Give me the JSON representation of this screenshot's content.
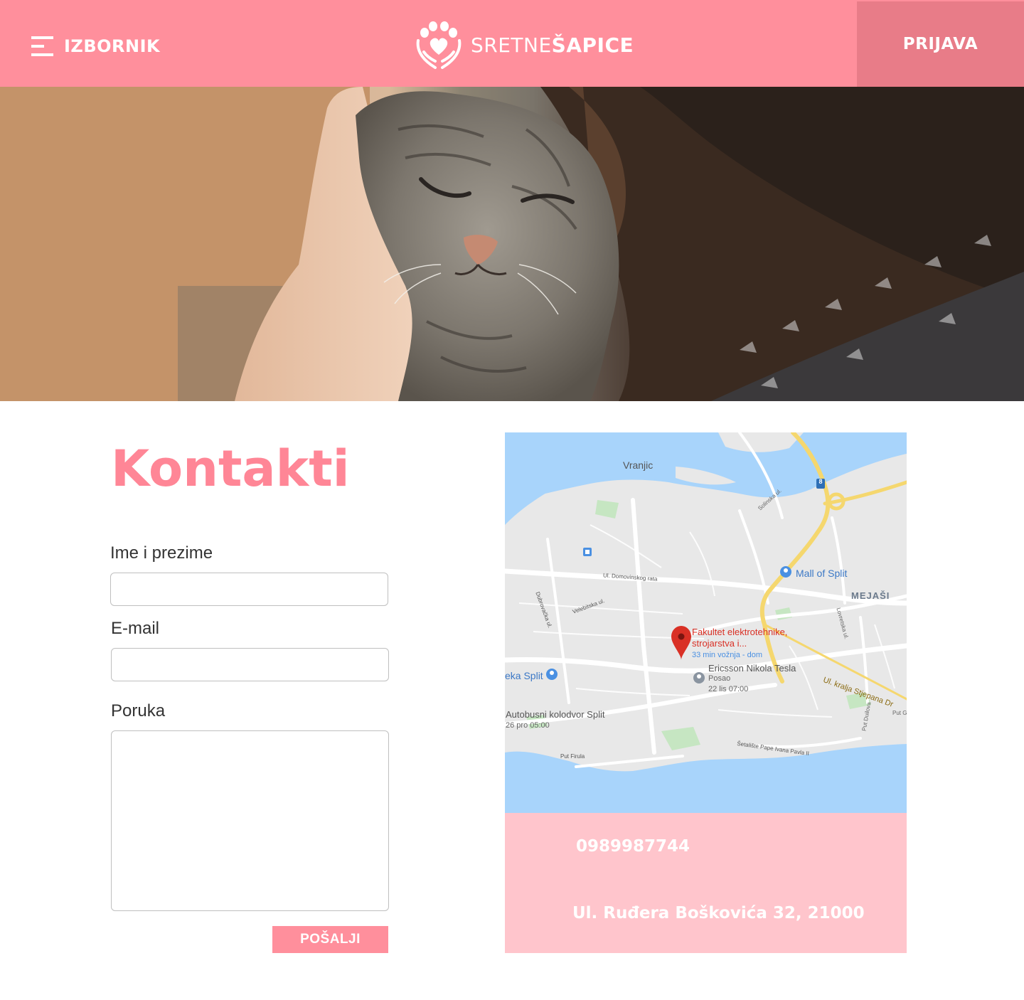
{
  "header": {
    "menu_label": "IZBORNIK",
    "logo_text_light": "SRETNE",
    "logo_text_bold": "ŠAPICE",
    "login_label": "PRIJAVA",
    "brand_color": "#ff8f9c",
    "login_bg_color": "#e87c88"
  },
  "contact": {
    "title": "Kontakti",
    "fields": {
      "name_label": "Ime i prezime",
      "email_label": "E-mail",
      "message_label": "Poruka",
      "name_value": "",
      "email_value": "",
      "message_value": ""
    },
    "send_label": "POŠALJI"
  },
  "map": {
    "labels": {
      "vranjic": "Vranjic",
      "mall": "Mall of Split",
      "mejasi": "MEJAŠI",
      "pin_line1": "Fakultet elektrotehnike,",
      "pin_line2": "strojarstva i...",
      "pin_sub": "33 min vožnja - dom",
      "ericsson": "Ericsson Nikola Tesla",
      "ericsson_sub1": "Posao",
      "ericsson_sub2": "22 lis 07:00",
      "bus": "Autobusni kolodvor Split",
      "bus_sub": "26 pro 05:00",
      "split": "eka Split",
      "domovinskog": "Ul. Domovinskog rata",
      "velebitska": "Velebitska ul.",
      "dubrovacka": "Dubrovačka ul.",
      "solinska": "Solinska ul.",
      "lovretska": "Lovretska ul.",
      "stjepana": "Ul. kralja Stjepana Dr",
      "duilova": "Put Duilova",
      "put": "Put G",
      "setaliste": "Šetalište Pape Ivana Pavla II",
      "firula": "Put Firula",
      "road8": "8"
    }
  },
  "info": {
    "phone": "0989987744",
    "address": "Ul. Ruđera Boškovića 32, 21000"
  }
}
